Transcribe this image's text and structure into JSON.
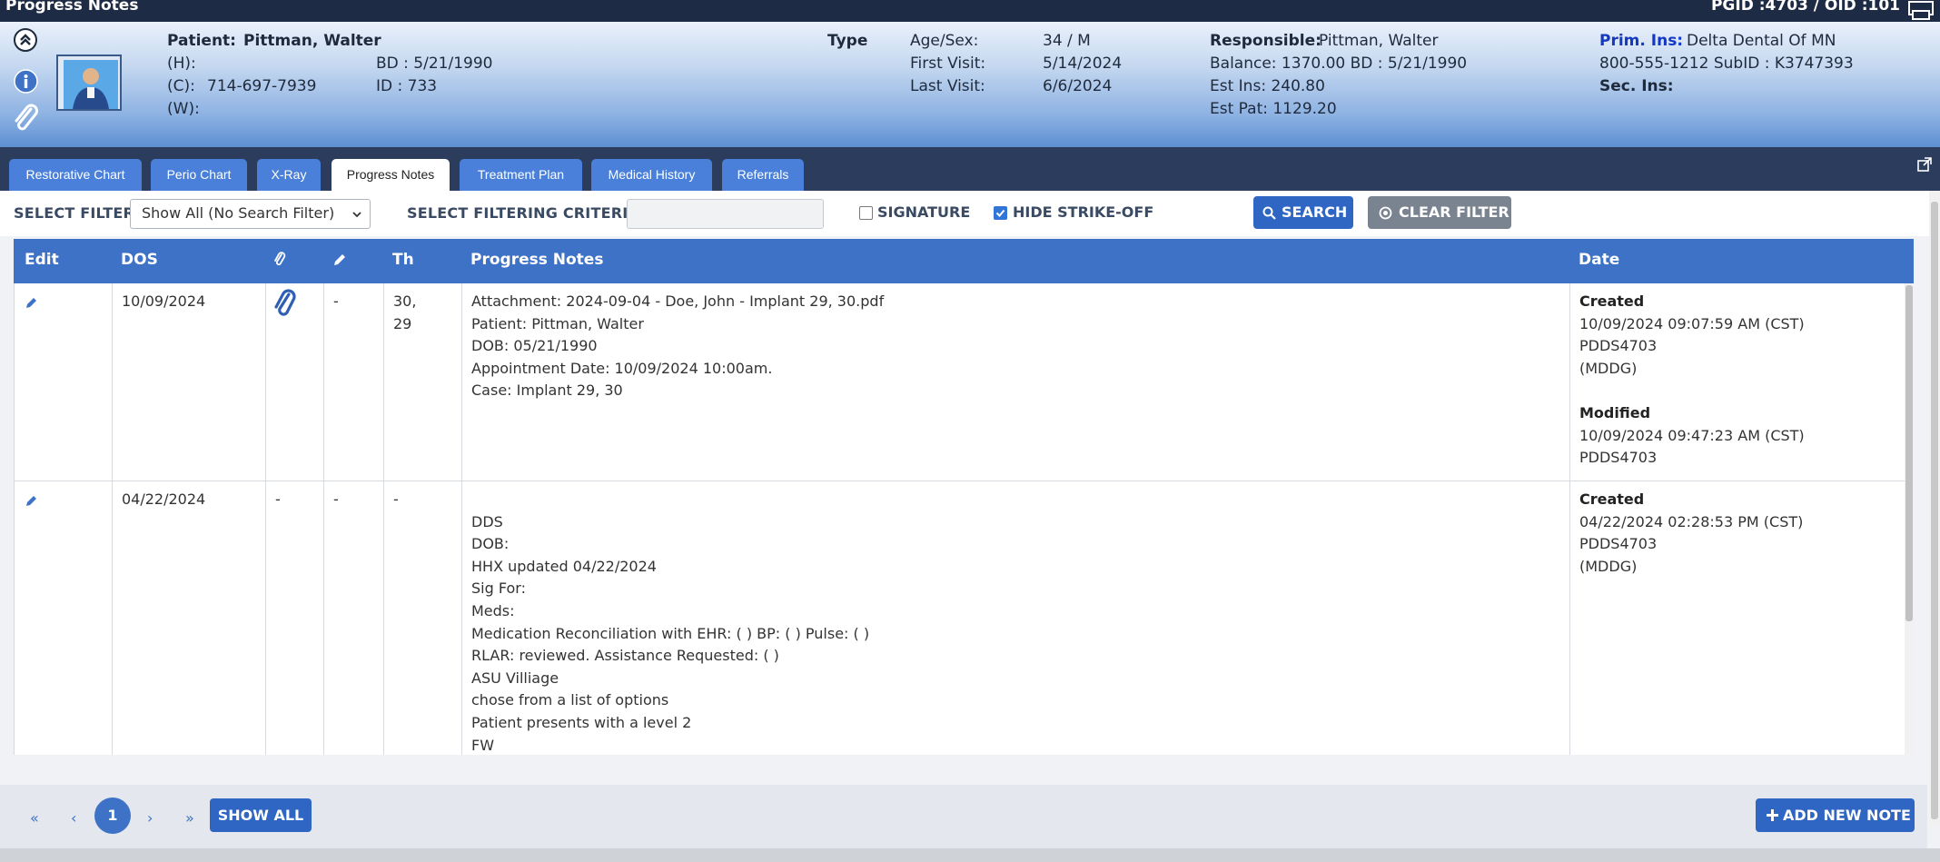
{
  "window": {
    "title": "Progress Notes",
    "ids": "PGID :4703  /  OID :101"
  },
  "patient": {
    "patient_label": "Patient:",
    "patient_name": "Pittman, Walter",
    "home_label": "(H):",
    "cell_label": "(C):",
    "cell_phone": "714-697-7939",
    "work_label": "(W):",
    "bd_label": "BD : 5/21/1990",
    "id_label": "ID : 733",
    "type_label": "Type",
    "age_sex_label": "Age/Sex:",
    "age_sex_value": "34 / M",
    "first_visit_label": "First Visit:",
    "first_visit_value": "5/14/2024",
    "last_visit_label": "Last Visit:",
    "last_visit_value": "6/6/2024",
    "responsible_label": "Responsible:",
    "responsible_value": "Pittman, Walter",
    "balance_line": "Balance: 1370.00    BD : 5/21/1990",
    "est_ins_line": "Est Ins:  240.80",
    "est_pat_line": "Est Pat: 1129.20",
    "prim_ins_label": "Prim. Ins:",
    "prim_ins_value": "Delta Dental Of MN",
    "prim_ins_line2": "800-555-1212  SubID : K3747393",
    "sec_ins_label": "Sec. Ins:"
  },
  "tabs": [
    {
      "label": "Restorative Chart",
      "active": false
    },
    {
      "label": "Perio Chart",
      "active": false
    },
    {
      "label": "X-Ray",
      "active": false
    },
    {
      "label": "Progress Notes",
      "active": true
    },
    {
      "label": "Treatment Plan",
      "active": false
    },
    {
      "label": "Medical History",
      "active": false
    },
    {
      "label": "Referrals",
      "active": false
    }
  ],
  "filter": {
    "select_filter_label": "SELECT FILTER",
    "select_value": "Show All (No Search Filter)",
    "criteria_label": "SELECT FILTERING CRITERIA",
    "criteria_value": "",
    "signature_label": "SIGNATURE",
    "signature_checked": false,
    "hide_strike_label": "HIDE STRIKE-OFF",
    "hide_strike_checked": true,
    "search_label": "SEARCH",
    "clear_label": "CLEAR FILTER"
  },
  "table": {
    "headers": {
      "edit": "Edit",
      "dos": "DOS",
      "th": "Th",
      "notes": "Progress Notes",
      "date": "Date"
    },
    "rows": [
      {
        "dos": "10/09/2024",
        "attachment": "",
        "sig": "-",
        "th_line1": "30,",
        "th_line2": "29",
        "notes": [
          "Attachment: 2024-09-04 - Doe, John - Implant 29, 30.pdf",
          "Patient: Pittman, Walter",
          "DOB: 05/21/1990",
          "Appointment Date: 10/09/2024 10:00am.",
          "Case: Implant  29, 30"
        ],
        "created_label": "Created",
        "created_time": "10/09/2024 09:07:59 AM (CST)",
        "created_by": "PDDS4703",
        "created_loc": "(MDDG)",
        "modified_label": "Modified",
        "modified_time": "10/09/2024 09:47:23 AM (CST)",
        "modified_by": "PDDS4703"
      },
      {
        "dos": "04/22/2024",
        "attachment": "-",
        "sig": "-",
        "th_line1": "-",
        "notes": [
          "DDS",
          "DOB:",
          "HHX updated 04/22/2024",
          "Sig For:",
          "Meds:",
          "Medication Reconciliation with EHR:  (  )    BP: (  ) Pulse: (  )",
          "RLAR: reviewed.  Assistance Requested: (  )",
          "ASU Villiage",
          "chose from a list of options",
          "Patient presents with a level 2",
          "FW"
        ],
        "created_label": "Created",
        "created_time": "04/22/2024 02:28:53 PM (CST)",
        "created_by": "PDDS4703",
        "created_loc": "(MDDG)"
      }
    ]
  },
  "pager": {
    "first": "«",
    "prev": "‹",
    "current": "1",
    "next": "›",
    "last": "»",
    "show_all": "SHOW ALL",
    "add_new": "ADD NEW NOTE"
  },
  "colors": {
    "accent": "#3d72c6",
    "tab": "#4a80d9",
    "titlebar": "#1e2b44",
    "tabbar": "#2c3c5c"
  }
}
